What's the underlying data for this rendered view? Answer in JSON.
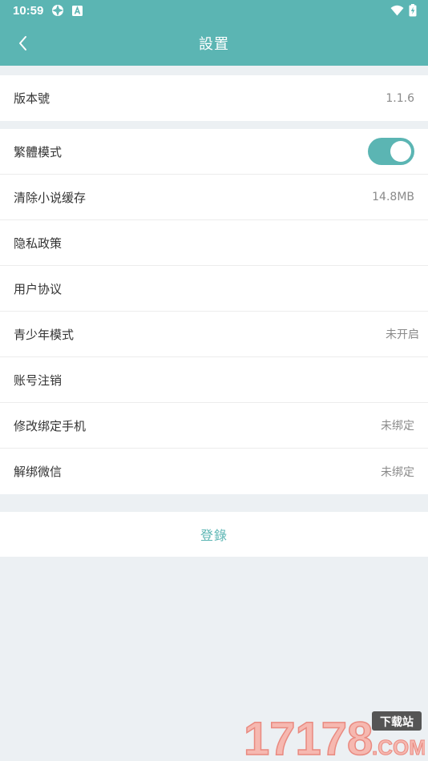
{
  "status_bar": {
    "time": "10:59",
    "icons": [
      "sync-icon",
      "a-badge-icon",
      "wifi-icon",
      "battery-charging-icon"
    ]
  },
  "app_bar": {
    "title": "設置",
    "back_icon": "chevron-left-icon"
  },
  "version": {
    "label": "版本號",
    "value": "1.1.6"
  },
  "settings": {
    "traditional_mode": {
      "label": "繁體模式",
      "enabled": true
    },
    "clear_cache": {
      "label": "清除小说缓存",
      "value": "14.8MB"
    },
    "privacy_policy": {
      "label": "隐私政策"
    },
    "user_agreement": {
      "label": "用户协议"
    },
    "youth_mode": {
      "label": "青少年模式",
      "value": "未开启"
    },
    "account_cancel": {
      "label": "账号注销"
    },
    "change_phone": {
      "label": "修改绑定手机",
      "value": "未绑定"
    },
    "unbind_wechat": {
      "label": "解绑微信",
      "value": "未绑定"
    }
  },
  "login": {
    "label": "登錄"
  },
  "colors": {
    "accent": "#5bb5b3",
    "background": "#ecf0f3",
    "value_text": "#8a8a8a"
  },
  "watermark": {
    "text": "17178",
    "badge": "下载站",
    "suffix": ".COM"
  }
}
